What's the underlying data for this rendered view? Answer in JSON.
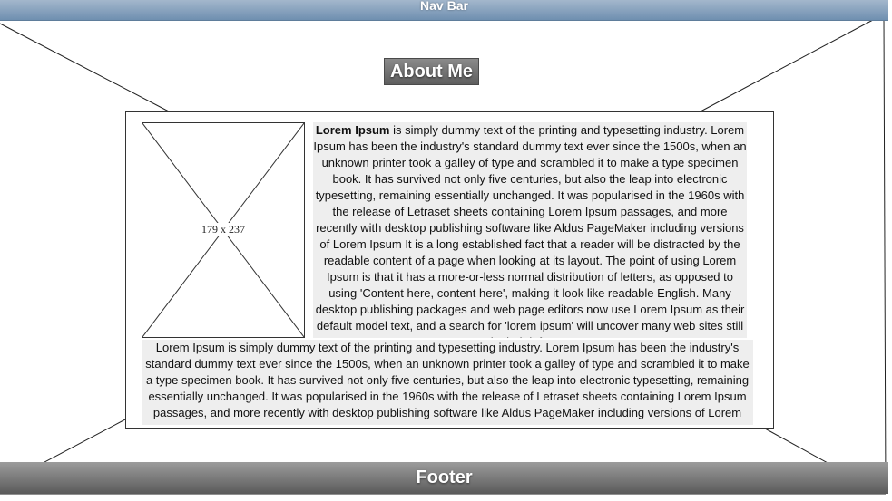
{
  "navbar": {
    "label": "Nav Bar"
  },
  "page": {
    "title": "About Me"
  },
  "image_placeholder": {
    "dimensions_label": "179 x 237"
  },
  "text_block_1": {
    "bold": "Lorem Ipsum",
    "body": " is simply dummy text of the printing and typesetting industry. Lorem Ipsum has been the industry's standard dummy text ever since the 1500s, when an unknown printer took a galley of type and scrambled it to make a type specimen book. It has survived not only five centuries, but also the leap into electronic typesetting, remaining essentially unchanged. It was popularised in the 1960s with the release of Letraset sheets containing Lorem Ipsum passages, and more recently with desktop publishing software like Aldus PageMaker including versions of Lorem Ipsum It is a long established fact that a reader will be distracted by the readable content of a page when looking at its layout. The point of using Lorem Ipsum is that it has a more-or-less normal distribution of letters, as opposed to using 'Content here, content here', making it look like readable English. Many desktop publishing packages and web page editors now use Lorem Ipsum as their default model text, and a search for 'lorem ipsum' will uncover many web sites still in their infancy."
  },
  "text_block_2": {
    "body": "Lorem Ipsum is simply dummy text of the printing and typesetting industry. Lorem Ipsum has been the industry's standard dummy text ever since the 1500s, when an unknown printer took a galley of type and scrambled it to make a type specimen book. It has survived not only five centuries, but also the leap into electronic typesetting, remaining essentially unchanged. It was popularised in the 1960s with the release of Letraset sheets containing Lorem Ipsum passages, and more recently with desktop publishing software like Aldus PageMaker including versions of Lorem Ipsum."
  },
  "footer": {
    "label": "Footer"
  }
}
